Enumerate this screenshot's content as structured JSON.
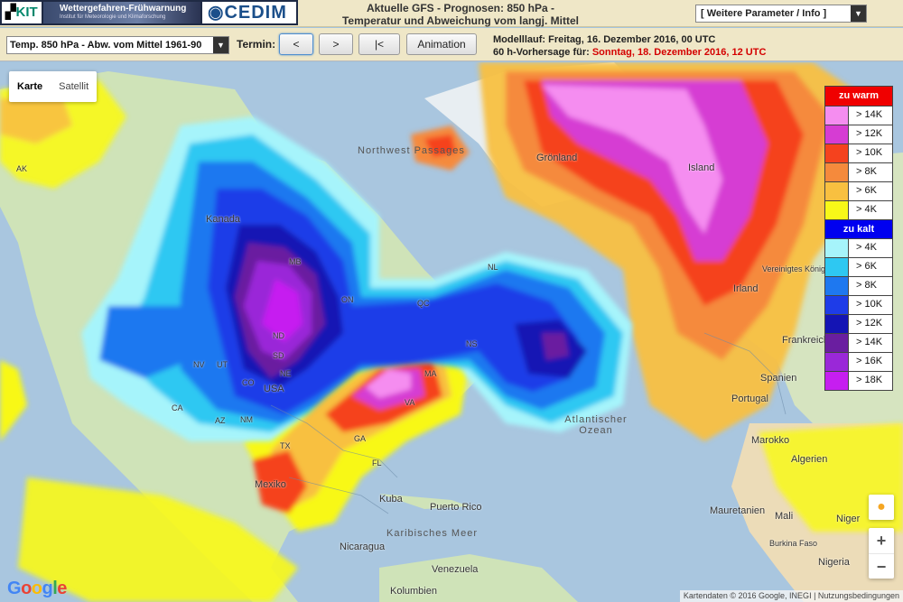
{
  "header": {
    "logo_kit": "KIT",
    "logo_wf_title": "Wettergefahren-Frühwarnung",
    "logo_wf_sub": "Institut für Meteorologie und Klimaforschung",
    "logo_cedim": "CEDIM",
    "title_line1": "Aktuelle GFS - Prognosen: 850 hPa -",
    "title_line2": "Temperatur und Abweichung vom langj. Mittel",
    "param_select": "[ Weitere Parameter / Info ]"
  },
  "toolbar": {
    "field_select": "Temp. 850 hPa - Abw. vom Mittel 1961-90",
    "termin_label": "Termin:",
    "prev": "<",
    "next": ">",
    "first": "|<",
    "animation": "Animation",
    "run_line": "Modelllauf: Freitag, 16. Dezember 2016, 00 UTC",
    "forecast_prefix": "60 h-Vorhersage für:",
    "forecast_date": "Sonntag, 18. Dezember 2016, 12 UTC"
  },
  "maptype": {
    "map": "Karte",
    "satellite": "Satellit"
  },
  "legend": {
    "warm_title": "zu warm",
    "cold_title": "zu kalt",
    "warm": [
      {
        "label": "> 14K",
        "color": "#f58df0"
      },
      {
        "label": "> 12K",
        "color": "#d63cd3"
      },
      {
        "label": "> 10K",
        "color": "#f5421e"
      },
      {
        "label": "> 8K",
        "color": "#f58a3c"
      },
      {
        "label": "> 6K",
        "color": "#f8c040"
      },
      {
        "label": "> 4K",
        "color": "#f8f818"
      }
    ],
    "cold": [
      {
        "label": "> 4K",
        "color": "#a6f4fb"
      },
      {
        "label": "> 6K",
        "color": "#2ec8f2"
      },
      {
        "label": "> 8K",
        "color": "#1e78f0"
      },
      {
        "label": "> 10K",
        "color": "#1e3ce8"
      },
      {
        "label": "> 12K",
        "color": "#1414b4"
      },
      {
        "label": "> 14K",
        "color": "#6a1ea0"
      },
      {
        "label": "> 16K",
        "color": "#9a28d8"
      },
      {
        "label": "> 18K",
        "color": "#c61ef0"
      }
    ],
    "warm_head_color": "#f00000",
    "cold_head_color": "#0000f0"
  },
  "map_labels": {
    "kanada": "Kanada",
    "usa": "USA",
    "mexiko": "Mexiko",
    "kuba": "Kuba",
    "puerto_rico": "Puerto Rico",
    "karibisches_meer": "Karibisches Meer",
    "nicaragua": "Nicaragua",
    "venezuela": "Venezuela",
    "kolumbien": "Kolumbien",
    "northwest_passages": "Northwest Passages",
    "groenland": "Grönland",
    "island": "Island",
    "irland": "Irland",
    "vereinigtes_koenigreich": "Vereinigtes Königreich",
    "frankreich": "Frankreich",
    "spanien": "Spanien",
    "portugal": "Portugal",
    "marokko": "Marokko",
    "algerien": "Algerien",
    "mauretanien": "Mauretanien",
    "mali": "Mali",
    "niger": "Niger",
    "burkina_faso": "Burkina Faso",
    "nigeria": "Nigeria",
    "atlantischer_ozean": "Atlantischer Ozean",
    "ak": "AK",
    "mb": "MB",
    "on": "ON",
    "qc": "QC",
    "nl": "NL",
    "nd": "ND",
    "sd": "SD",
    "ne": "NE",
    "nv": "NV",
    "ut": "UT",
    "co": "CO",
    "ca": "CA",
    "az": "AZ",
    "nm": "NM",
    "tx": "TX",
    "fl": "FL",
    "ga": "GA",
    "va": "VA",
    "ma": "MA",
    "ns": "NS"
  },
  "attribution": "Kartendaten © 2016 Google, INEGI",
  "terms": "Nutzungsbedingungen",
  "google": "Google"
}
